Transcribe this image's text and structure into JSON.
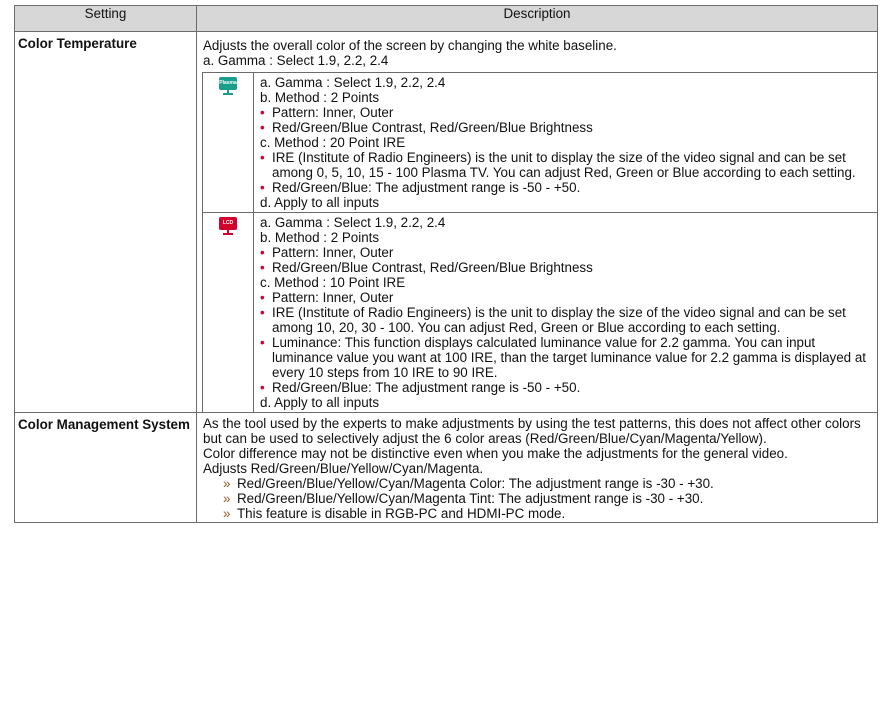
{
  "header": {
    "col_setting": "Setting",
    "col_description": "Description"
  },
  "color_temperature": {
    "name": "Color Temperature",
    "intro": [
      "Adjusts the overall color of the screen by changing the white baseline.",
      "a. Gamma : Select 1.9, 2.2, 2.4"
    ],
    "plasma": {
      "icon": "plasma-tv-icon",
      "icon_text": "Plasma",
      "icon_color": "#1a9e8c",
      "lines": [
        {
          "type": "plain",
          "text": "a. Gamma : Select 1.9, 2.2, 2.4"
        },
        {
          "type": "plain",
          "text": "b. Method : 2 Points"
        },
        {
          "type": "bullet",
          "text": "Pattern: Inner, Outer"
        },
        {
          "type": "bullet",
          "text": "Red/Green/Blue Contrast, Red/Green/Blue Brightness"
        },
        {
          "type": "plain",
          "text": "c. Method : 20 Point IRE"
        },
        {
          "type": "bullet",
          "text": "IRE (Institute of Radio Engineers) is the unit to display the size of the video signal and can be set among 0, 5, 10, 15 - 100 Plasma TV. You can adjust Red, Green or Blue according to each setting."
        },
        {
          "type": "bullet",
          "text": "Red/Green/Blue: The adjustment range is -50 - +50."
        },
        {
          "type": "plain",
          "text": "d. Apply to all inputs"
        }
      ]
    },
    "lcd": {
      "icon": "lcd-tv-icon",
      "icon_text": "LCD",
      "icon_color": "#d2002d",
      "lines": [
        {
          "type": "plain",
          "text": "a. Gamma : Select 1.9, 2.2, 2.4"
        },
        {
          "type": "plain",
          "text": "b. Method : 2 Points"
        },
        {
          "type": "bullet",
          "text": "Pattern: Inner, Outer"
        },
        {
          "type": "bullet",
          "text": "Red/Green/Blue Contrast, Red/Green/Blue Brightness"
        },
        {
          "type": "plain",
          "text": "c. Method : 10 Point IRE"
        },
        {
          "type": "bullet",
          "text": "Pattern: Inner, Outer"
        },
        {
          "type": "bullet",
          "text": "IRE (Institute of Radio Engineers) is the unit to display the size of the video signal and can be set among 10, 20, 30 - 100. You can adjust Red, Green or Blue according to each setting."
        },
        {
          "type": "bullet",
          "text": "Luminance: This function displays calculated luminance value for 2.2 gamma. You can input luminance value you want at 100 IRE, than the target luminance value for 2.2 gamma is displayed at every 10 steps from 10 IRE to 90 IRE."
        },
        {
          "type": "bullet",
          "text": "Red/Green/Blue: The adjustment range is -50 - +50."
        },
        {
          "type": "plain",
          "text": "d. Apply to all inputs"
        }
      ]
    }
  },
  "color_management": {
    "name": "Color Management System",
    "paragraphs": [
      "As the tool used by the experts to make adjustments by using the test patterns, this does not affect other colors but can be used to selectively adjust the 6 color areas (Red/Green/Blue/Cyan/Magenta/Yellow).",
      "Color difference may not be distinctive even when you make the adjustments for the general video.",
      "Adjusts Red/Green/Blue/Yellow/Cyan/Magenta."
    ],
    "items": [
      "Red/Green/Blue/Yellow/Cyan/Magenta Color: The adjustment range is -30 - +30.",
      "Red/Green/Blue/Yellow/Cyan/Magenta Tint: The adjustment range is -30 - +30.",
      "This feature is disable in RGB-PC and HDMI-PC mode."
    ]
  }
}
